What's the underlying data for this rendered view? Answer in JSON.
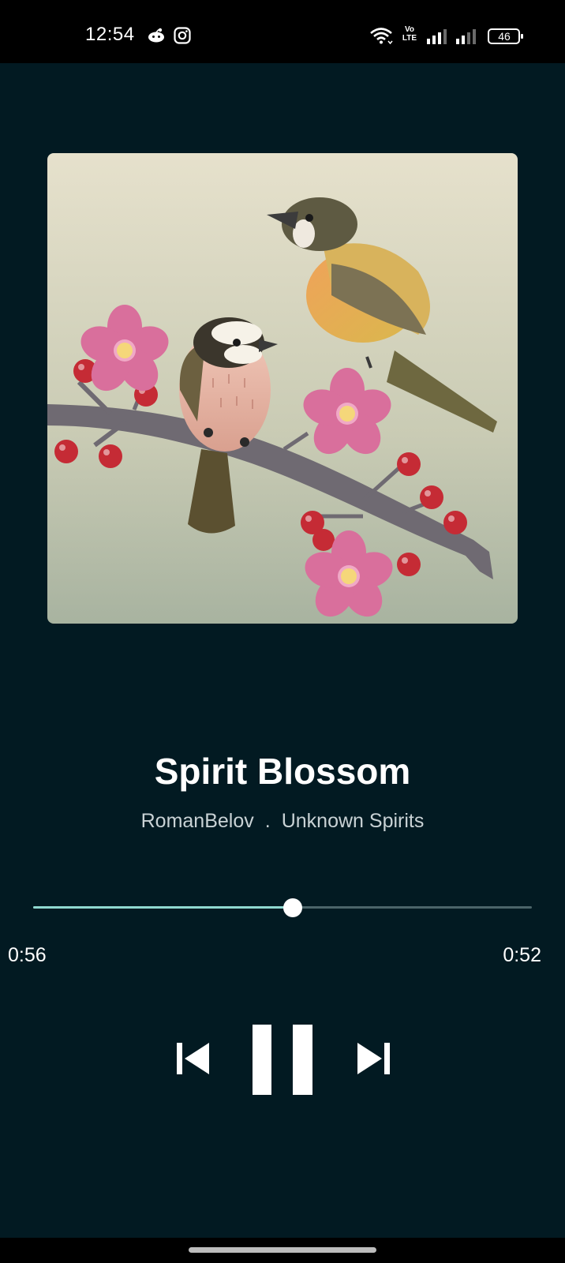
{
  "status_bar": {
    "time": "12:54",
    "network_label": "Vo LTE",
    "battery_level": "46",
    "icons": [
      "reddit-icon",
      "instagram-icon",
      "wifi-icon",
      "volte-icon",
      "signal-icon",
      "signal-icon-2",
      "battery-icon"
    ]
  },
  "player": {
    "album_art": "album-art-birds-on-blossom-branch",
    "title": "Spirit Blossom",
    "artist": "RomanBelov",
    "separator": ".",
    "album": "Unknown Spirits",
    "elapsed": "0:56",
    "remaining": "0:52",
    "progress": 0.52
  },
  "controls": {
    "previous": "skip-previous-icon",
    "play_pause": "pause-icon",
    "next": "skip-next-icon"
  },
  "colors": {
    "background": "#021a22",
    "accent": "#8fd9d0",
    "track_inactive": "#4b6469",
    "text_primary": "#ffffff",
    "text_secondary": "#c9d2d5"
  }
}
